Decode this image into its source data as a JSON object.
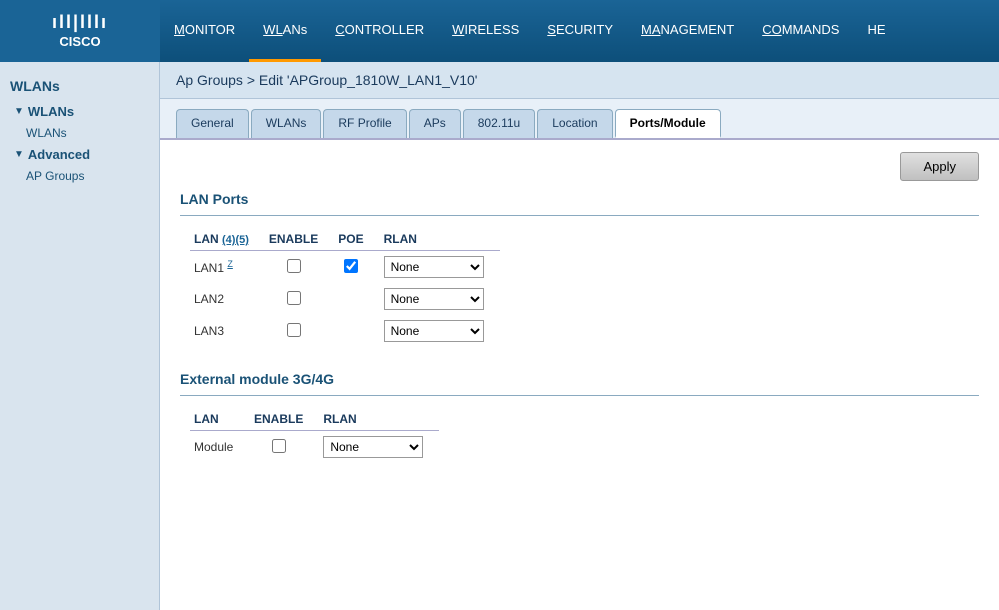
{
  "topbar": {
    "logo_waves": "ıll|lllı",
    "logo_text": "CISCO",
    "nav_items": [
      {
        "label": "MONITOR",
        "underline_index": 0,
        "active": false
      },
      {
        "label": "WLANs",
        "underline_index": 0,
        "active": true
      },
      {
        "label": "CONTROLLER",
        "underline_index": 0,
        "active": false
      },
      {
        "label": "WIRELESS",
        "underline_index": 0,
        "active": false
      },
      {
        "label": "SECURITY",
        "underline_index": 0,
        "active": false
      },
      {
        "label": "MANAGEMENT",
        "underline_index": 0,
        "active": false
      },
      {
        "label": "COMMANDS",
        "underline_index": 0,
        "active": false
      },
      {
        "label": "HE",
        "underline_index": 0,
        "active": false
      }
    ]
  },
  "sidebar": {
    "top_section": "WLANs",
    "subsections": [
      {
        "label": "WLANs",
        "items": [
          "WLANs"
        ]
      },
      {
        "label": "Advanced",
        "items": [
          "AP Groups"
        ]
      }
    ]
  },
  "breadcrumb": "Ap Groups > Edit  'APGroup_1810W_LAN1_V10'",
  "tabs": [
    {
      "label": "General",
      "active": false
    },
    {
      "label": "WLANs",
      "active": false
    },
    {
      "label": "RF Profile",
      "active": false
    },
    {
      "label": "APs",
      "active": false
    },
    {
      "label": "802.11u",
      "active": false
    },
    {
      "label": "Location",
      "active": false
    },
    {
      "label": "Ports/Module",
      "active": true
    }
  ],
  "apply_button": "Apply",
  "lan_ports_section": {
    "heading": "LAN Ports",
    "columns": [
      "LAN",
      "ENABLE",
      "POE",
      "RLAN"
    ],
    "footnote_link": "(4)(5)",
    "rows": [
      {
        "lan": "LAN1",
        "footnote": "Z",
        "enable": false,
        "poe": true,
        "rlan": "None"
      },
      {
        "lan": "LAN2",
        "footnote": "",
        "enable": false,
        "poe": false,
        "rlan": "None"
      },
      {
        "lan": "LAN3",
        "footnote": "",
        "enable": false,
        "poe": false,
        "rlan": "None"
      }
    ],
    "rlan_options": [
      "None"
    ]
  },
  "external_module_section": {
    "heading": "External module 3G/4G",
    "columns": [
      "LAN",
      "ENABLE",
      "RLAN"
    ],
    "rows": [
      {
        "lan": "Module",
        "enable": false,
        "rlan": "None"
      }
    ],
    "rlan_options": [
      "None"
    ]
  }
}
